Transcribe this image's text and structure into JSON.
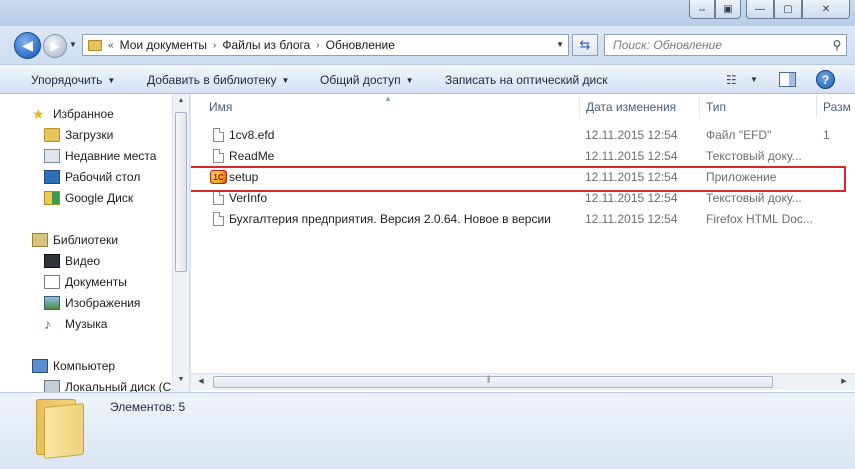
{
  "window_controls": [
    "⇔",
    "▣",
    "—",
    "▢",
    "✕"
  ],
  "address": {
    "crumbs": [
      "Мои документы",
      "Файлы из блога",
      "Обновление"
    ],
    "separator": "«",
    "arrow": "›"
  },
  "search": {
    "placeholder": "Поиск: Обновление"
  },
  "toolbar": {
    "organize": "Упорядочить",
    "add_library": "Добавить в библиотеку",
    "share": "Общий доступ",
    "burn": "Записать на оптический диск",
    "help": "?"
  },
  "nav": {
    "favorites": {
      "label": "Избранное",
      "items": [
        "Загрузки",
        "Недавние места",
        "Рабочий стол",
        "Google Диск"
      ]
    },
    "libraries": {
      "label": "Библиотеки",
      "items": [
        "Видео",
        "Документы",
        "Изображения",
        "Музыка"
      ]
    },
    "computer": {
      "label": "Компьютер",
      "items": [
        "Локальный диск (C"
      ]
    }
  },
  "columns": {
    "name": "Имя",
    "date": "Дата изменения",
    "type": "Тип",
    "size": "Разм"
  },
  "files": [
    {
      "name": "1cv8.efd",
      "date": "12.11.2015 12:54",
      "type": "Файл \"EFD\"",
      "size": "1",
      "icon": "file-icon"
    },
    {
      "name": "ReadMe",
      "date": "12.11.2015 12:54",
      "type": "Текстовый доку...",
      "size": "",
      "icon": "text-file-icon"
    },
    {
      "name": "setup",
      "date": "12.11.2015 12:54",
      "type": "Приложение",
      "size": "",
      "icon": "app-1c-icon"
    },
    {
      "name": "VerInfo",
      "date": "12.11.2015 12:54",
      "type": "Текстовый доку...",
      "size": "",
      "icon": "text-file-icon"
    },
    {
      "name": "Бухгалтерия предприятия. Версия 2.0.64. Новое в версии",
      "date": "12.11.2015 12:54",
      "type": "Firefox HTML Doc...",
      "size": "",
      "icon": "html-file-icon"
    }
  ],
  "status": {
    "items_count": "Элементов: 5"
  },
  "colors": {
    "highlight": "#d8262c",
    "nav_back": "#2d6fc4"
  }
}
